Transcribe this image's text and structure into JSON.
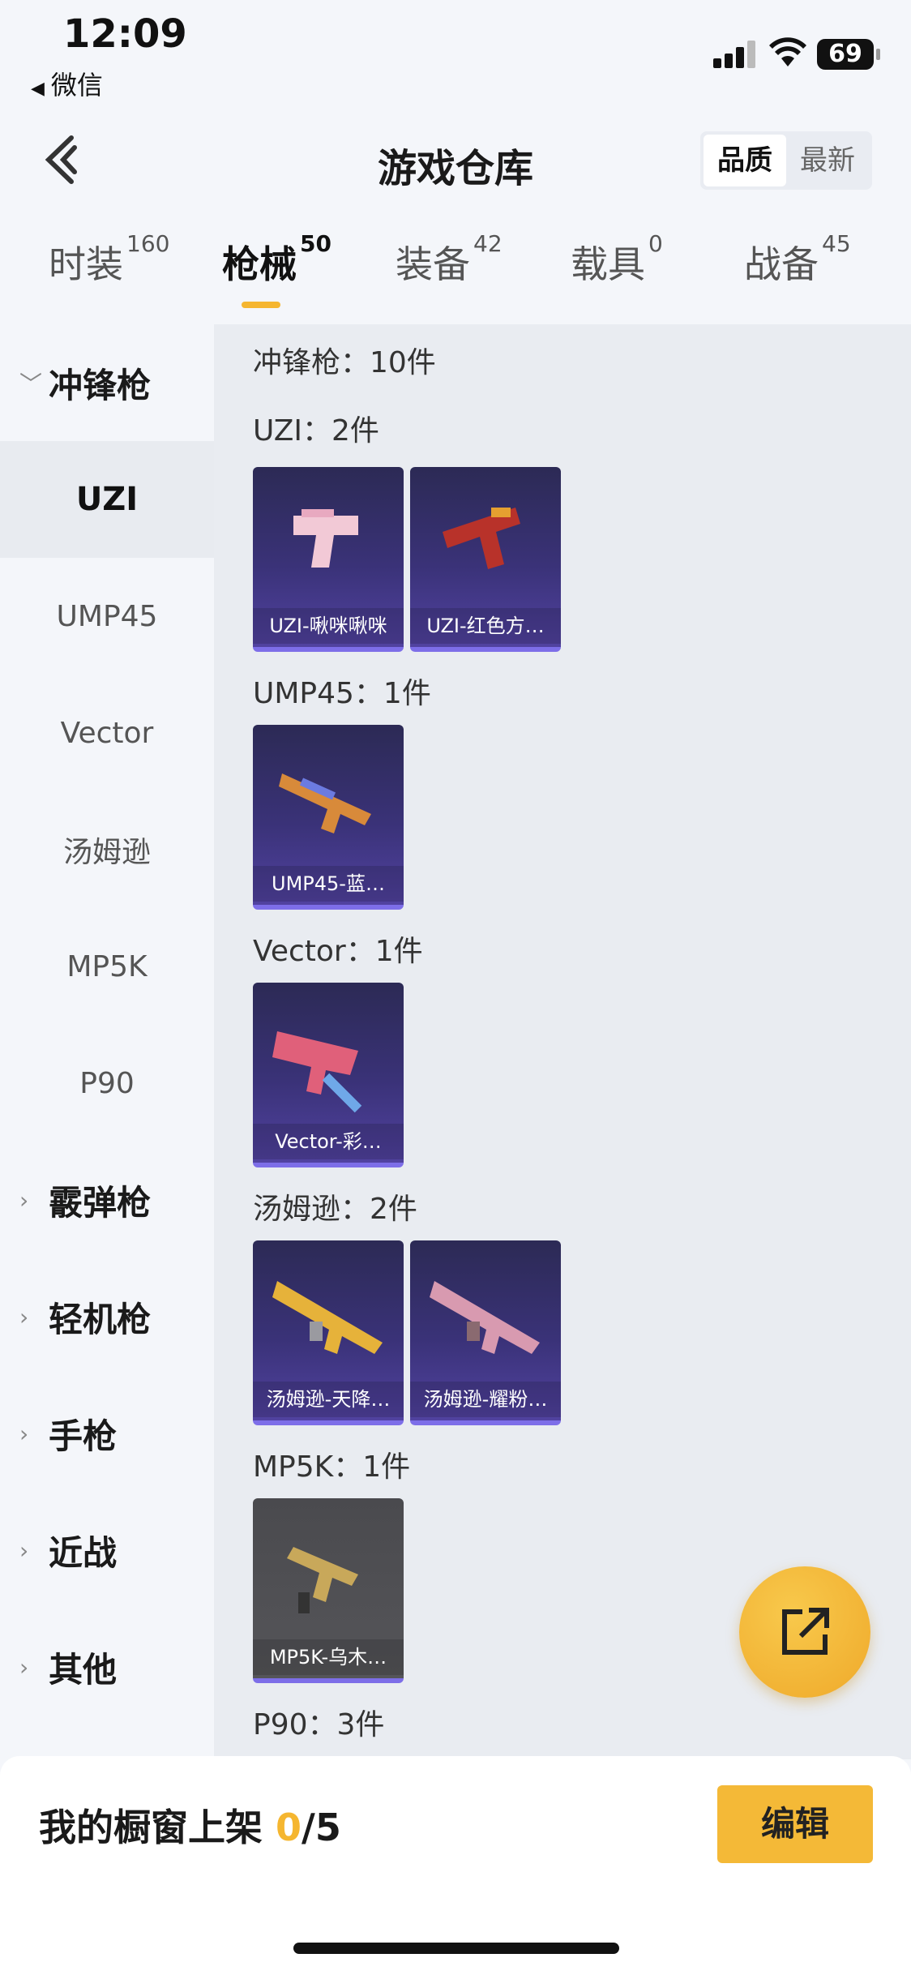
{
  "status_bar": {
    "time": "12:09",
    "back_app": "微信",
    "battery": "69"
  },
  "header": {
    "title": "游戏仓库",
    "sort_options": [
      "品质",
      "最新"
    ],
    "sort_active": "品质"
  },
  "tabs": [
    {
      "label": "时装",
      "count": "160"
    },
    {
      "label": "枪械",
      "count": "50"
    },
    {
      "label": "装备",
      "count": "42"
    },
    {
      "label": "载具",
      "count": "0"
    },
    {
      "label": "战备",
      "count": "45"
    }
  ],
  "sidebar": {
    "categories": [
      "冲锋枪",
      "霰弹枪",
      "轻机枪",
      "手枪",
      "近战",
      "其他"
    ],
    "sub_items": [
      "UZI",
      "UMP45",
      "Vector",
      "汤姆逊",
      "MP5K",
      "P90"
    ],
    "active_sub": "UZI"
  },
  "content": {
    "summary": "冲锋枪：10件",
    "groups": [
      {
        "label": "UZI：2件",
        "items": [
          "UZI-啾咪啾咪",
          "UZI-红色方…"
        ]
      },
      {
        "label": "UMP45：1件",
        "items": [
          "UMP45-蓝…"
        ]
      },
      {
        "label": "Vector：1件",
        "items": [
          "Vector-彩…"
        ]
      },
      {
        "label": "汤姆逊：2件",
        "items": [
          "汤姆逊-天降…",
          "汤姆逊-耀粉…"
        ]
      },
      {
        "label": "MP5K：1件",
        "items": [
          "MP5K-乌木…"
        ]
      },
      {
        "label": "P90：3件",
        "items": []
      }
    ]
  },
  "bottom": {
    "shelf_label": "我的橱窗上架",
    "shelf_count": "0",
    "shelf_total": "/5",
    "edit_label": "编辑"
  },
  "colors": {
    "accent": "#f5b630",
    "card_purple": "#3a3278",
    "card_border": "#7d6ee8"
  }
}
